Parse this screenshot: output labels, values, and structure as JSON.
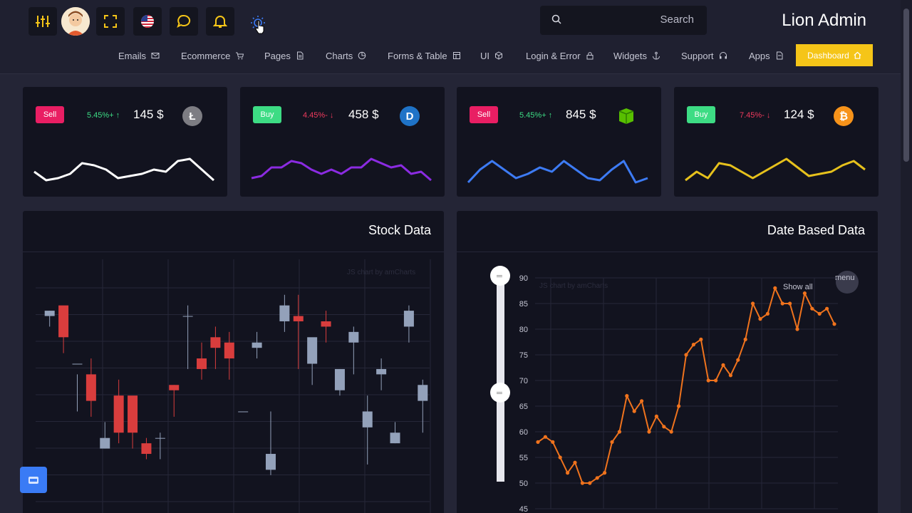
{
  "header": {
    "brand": "Lion Admin",
    "search": {
      "placeholder": "Search"
    },
    "icons": [
      "sliders-icon",
      "avatar",
      "fullscreen-icon",
      "us-flag-icon",
      "chat-icon",
      "bell-icon",
      "bulb-icon"
    ]
  },
  "nav": {
    "items": [
      {
        "label": "Emails",
        "icon": "mail-icon"
      },
      {
        "label": "Ecommerce",
        "icon": "cart-icon"
      },
      {
        "label": "Pages",
        "icon": "file-icon"
      },
      {
        "label": "Charts",
        "icon": "pie-icon"
      },
      {
        "label": "Forms & Table",
        "icon": "table-icon"
      },
      {
        "label": "UI",
        "icon": "box-icon"
      },
      {
        "label": "Login & Error",
        "icon": "lock-icon"
      },
      {
        "label": "Widgets",
        "icon": "anchor-icon"
      },
      {
        "label": "Support",
        "icon": "headset-icon"
      },
      {
        "label": "Apps",
        "icon": "doc-icon"
      }
    ],
    "dashboard": "Dashboard"
  },
  "cards": [
    {
      "badge": "Sell",
      "change": "5.45%+",
      "direction": "up",
      "price": "145 $",
      "coin": "litecoin-icon",
      "line_color": "#ffffff",
      "trend": [
        4.5,
        2.5,
        3.0,
        4.0,
        6.5,
        6.0,
        5.0,
        3.0,
        3.5,
        4.0,
        5.0,
        4.5,
        7.0,
        7.5,
        5.0,
        2.5
      ]
    },
    {
      "badge": "Buy",
      "change": "4.45%-",
      "direction": "down",
      "price": "458 $",
      "coin": "dash-icon",
      "line_color": "#8b2be2",
      "trend": [
        3.0,
        3.5,
        5.5,
        5.5,
        7.0,
        6.5,
        5.0,
        4.0,
        5.0,
        4.0,
        5.5,
        5.5,
        7.5,
        6.5,
        5.5,
        6.0,
        4.0,
        4.5,
        2.5
      ]
    },
    {
      "badge": "Sell",
      "change": "5.45%+",
      "direction": "up",
      "price": "845 $",
      "coin": "neo-icon",
      "line_color": "#3d7bf4",
      "trend": [
        2.0,
        5.0,
        7.0,
        5.0,
        3.0,
        4.0,
        5.5,
        4.5,
        7.0,
        5.0,
        3.0,
        2.5,
        5.0,
        7.0,
        2.0,
        3.0
      ]
    },
    {
      "badge": "Buy",
      "change": "7.45%-",
      "direction": "down",
      "price": "124 $",
      "coin": "bitcoin-icon",
      "line_color": "#e6c11c",
      "trend": [
        2.5,
        4.5,
        3.0,
        6.5,
        6.0,
        4.5,
        3.0,
        4.5,
        6.0,
        7.5,
        5.5,
        3.5,
        4.0,
        4.5,
        6.0,
        7.0,
        5.0
      ]
    }
  ],
  "panels": {
    "stock": {
      "title": "Stock Data",
      "credit": "JS chart by amCharts"
    },
    "date": {
      "title": "Date Based Data",
      "credit": "JS chart by amCharts",
      "show_all": "Show all",
      "menu": "menu"
    }
  },
  "chart_data": [
    {
      "type": "candlestick",
      "title": "Stock Data",
      "series": [
        {
          "name": "",
          "values": [
            [
              80,
              81,
              78,
              81
            ],
            [
              82,
              80,
              73,
              76
            ],
            [
              71,
              69,
              62,
              71
            ],
            [
              69,
              72,
              61,
              64
            ],
            [
              55,
              60,
              55,
              57
            ],
            [
              65,
              68,
              56,
              58
            ],
            [
              65,
              62,
              55,
              58
            ],
            [
              56,
              57,
              53,
              54
            ],
            [
              57,
              58,
              53,
              57
            ],
            [
              67,
              67,
              61,
              66
            ],
            [
              80,
              82,
              70,
              80
            ],
            [
              72,
              75,
              68,
              70
            ],
            [
              76,
              78,
              70,
              74
            ],
            [
              75,
              77,
              68,
              72
            ],
            [
              62,
              62,
              62,
              62
            ],
            [
              74,
              77,
              72,
              75
            ],
            [
              51,
              62,
              50,
              54
            ],
            [
              79,
              84,
              77,
              82
            ],
            [
              80,
              84,
              70,
              79
            ],
            [
              71,
              75,
              67,
              76
            ],
            [
              79,
              81,
              75,
              78
            ],
            [
              66,
              70,
              65,
              70
            ],
            [
              75,
              78,
              69,
              77
            ],
            [
              59,
              65,
              52,
              62
            ],
            [
              69,
              72,
              66,
              70
            ],
            [
              56,
              60,
              56,
              58
            ],
            [
              78,
              82,
              75,
              81
            ],
            [
              64,
              68,
              58,
              67
            ]
          ]
        }
      ]
    },
    {
      "type": "line",
      "title": "Date Based Data",
      "ylim": [
        45,
        90
      ],
      "yticks": [
        45,
        50,
        55,
        60,
        65,
        70,
        75,
        80,
        85,
        90
      ],
      "series": [
        {
          "name": "",
          "color": "#f0731d",
          "values": [
            58,
            59,
            58,
            55,
            52,
            54,
            50,
            50,
            51,
            52,
            58,
            60,
            67,
            64,
            66,
            60,
            63,
            61,
            60,
            65,
            75,
            77,
            78,
            70,
            70,
            73,
            71,
            74,
            78,
            85,
            82,
            83,
            88,
            85,
            85,
            80,
            87,
            84,
            83,
            84,
            81
          ]
        }
      ]
    }
  ]
}
